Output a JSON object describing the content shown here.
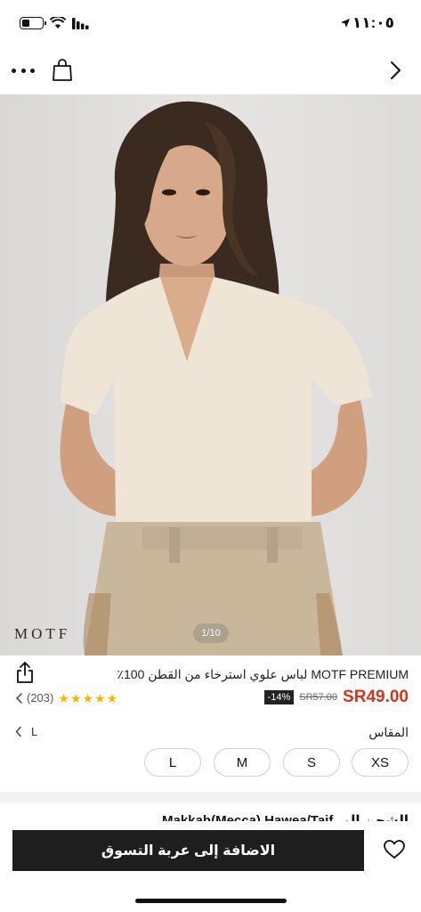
{
  "status": {
    "time": "١١:٠٥"
  },
  "image": {
    "brand_watermark": "MOTF",
    "counter": "1/10"
  },
  "product": {
    "title": "MOTF PREMIUM لباس علوي استرخاء من القطن 100٪",
    "price": "SR49.00",
    "old_price": "SR57.00",
    "discount": "-14%",
    "reviews_count": "(203)",
    "rating_stars": 5
  },
  "size": {
    "label": "المقاس",
    "selected": "L",
    "options": [
      "XS",
      "S",
      "M",
      "L"
    ]
  },
  "shipping": {
    "peek_text": "الشحن إلى Makkah(Mecca) Hawea/Taif"
  },
  "actions": {
    "add_to_cart": "الاضافة إلى عربة التسوق"
  },
  "icons": [
    "battery-icon",
    "wifi-icon",
    "signal-icon",
    "location-arrow-icon",
    "more-icon",
    "shopping-bag-icon",
    "chevron-right-icon",
    "share-icon",
    "chevron-left-icon",
    "star-icon",
    "heart-icon"
  ],
  "colors": {
    "price": "#d6331b",
    "star": "#f7b500",
    "button": "#1e1e1e",
    "discount_badge": "#222222"
  }
}
